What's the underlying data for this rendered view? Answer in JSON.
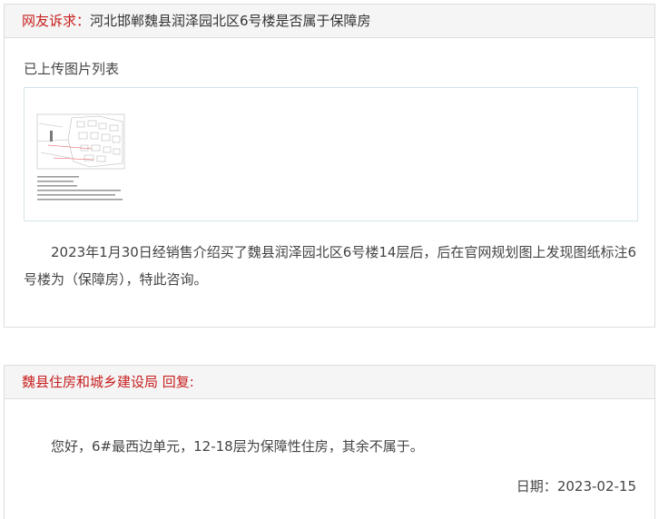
{
  "complaint": {
    "label": "网友诉求：",
    "title": "河北邯郸魏县润泽园北区6号楼是否属于保障房",
    "images_section_label": "已上传图片列表",
    "images": [
      {
        "name": "uploaded-plan-image"
      }
    ],
    "body": "2023年1月30日经销售介绍买了魏县润泽园北区6号楼14层后，后在官网规划图上发现图纸标注6号楼为（保障房），特此咨询。"
  },
  "reply": {
    "header": "魏县住房和城乡建设局 回复:",
    "body": "您好，6#最西边单元，12-18层为保障性住房，其余不属于。",
    "date_label": "日期：",
    "date": "2023-02-15"
  },
  "colors": {
    "label_red": "#c81e1e",
    "header_bg": "#f5f5f5",
    "border": "#dedede",
    "image_box_border": "#d3e3ea",
    "text": "#333333"
  }
}
